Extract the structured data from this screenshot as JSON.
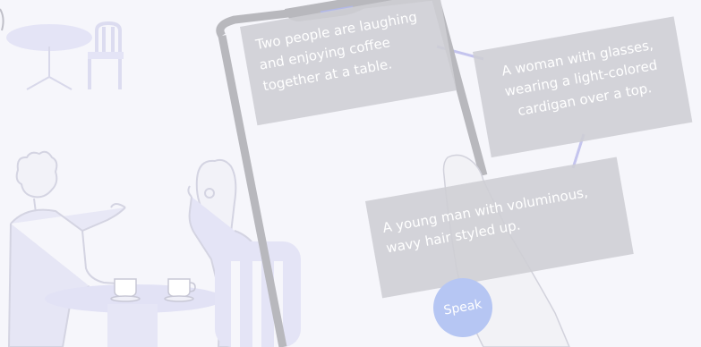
{
  "captions": {
    "scene": "Two people are laughing and enjoying coffee together at a table.",
    "woman": "A woman with glasses, wearing a light-colored cardigan over a top.",
    "man": "A young man with voluminous, wavy hair styled up."
  },
  "speak_button": {
    "label": "Speak"
  },
  "colors": {
    "background": "#f6f6fb",
    "illustration_fill": "#e4e4f6",
    "illustration_line": "#d6d6e4",
    "phone_frame": "#b8b8bd",
    "caption_box": "#cecdd4",
    "connector": "#c3c3ef",
    "speak_button": "#b6c6f3"
  },
  "icons": [
    "cafe-table-icon",
    "chair-icon",
    "coffee-cup-icon",
    "phone-icon",
    "hand-icon"
  ]
}
